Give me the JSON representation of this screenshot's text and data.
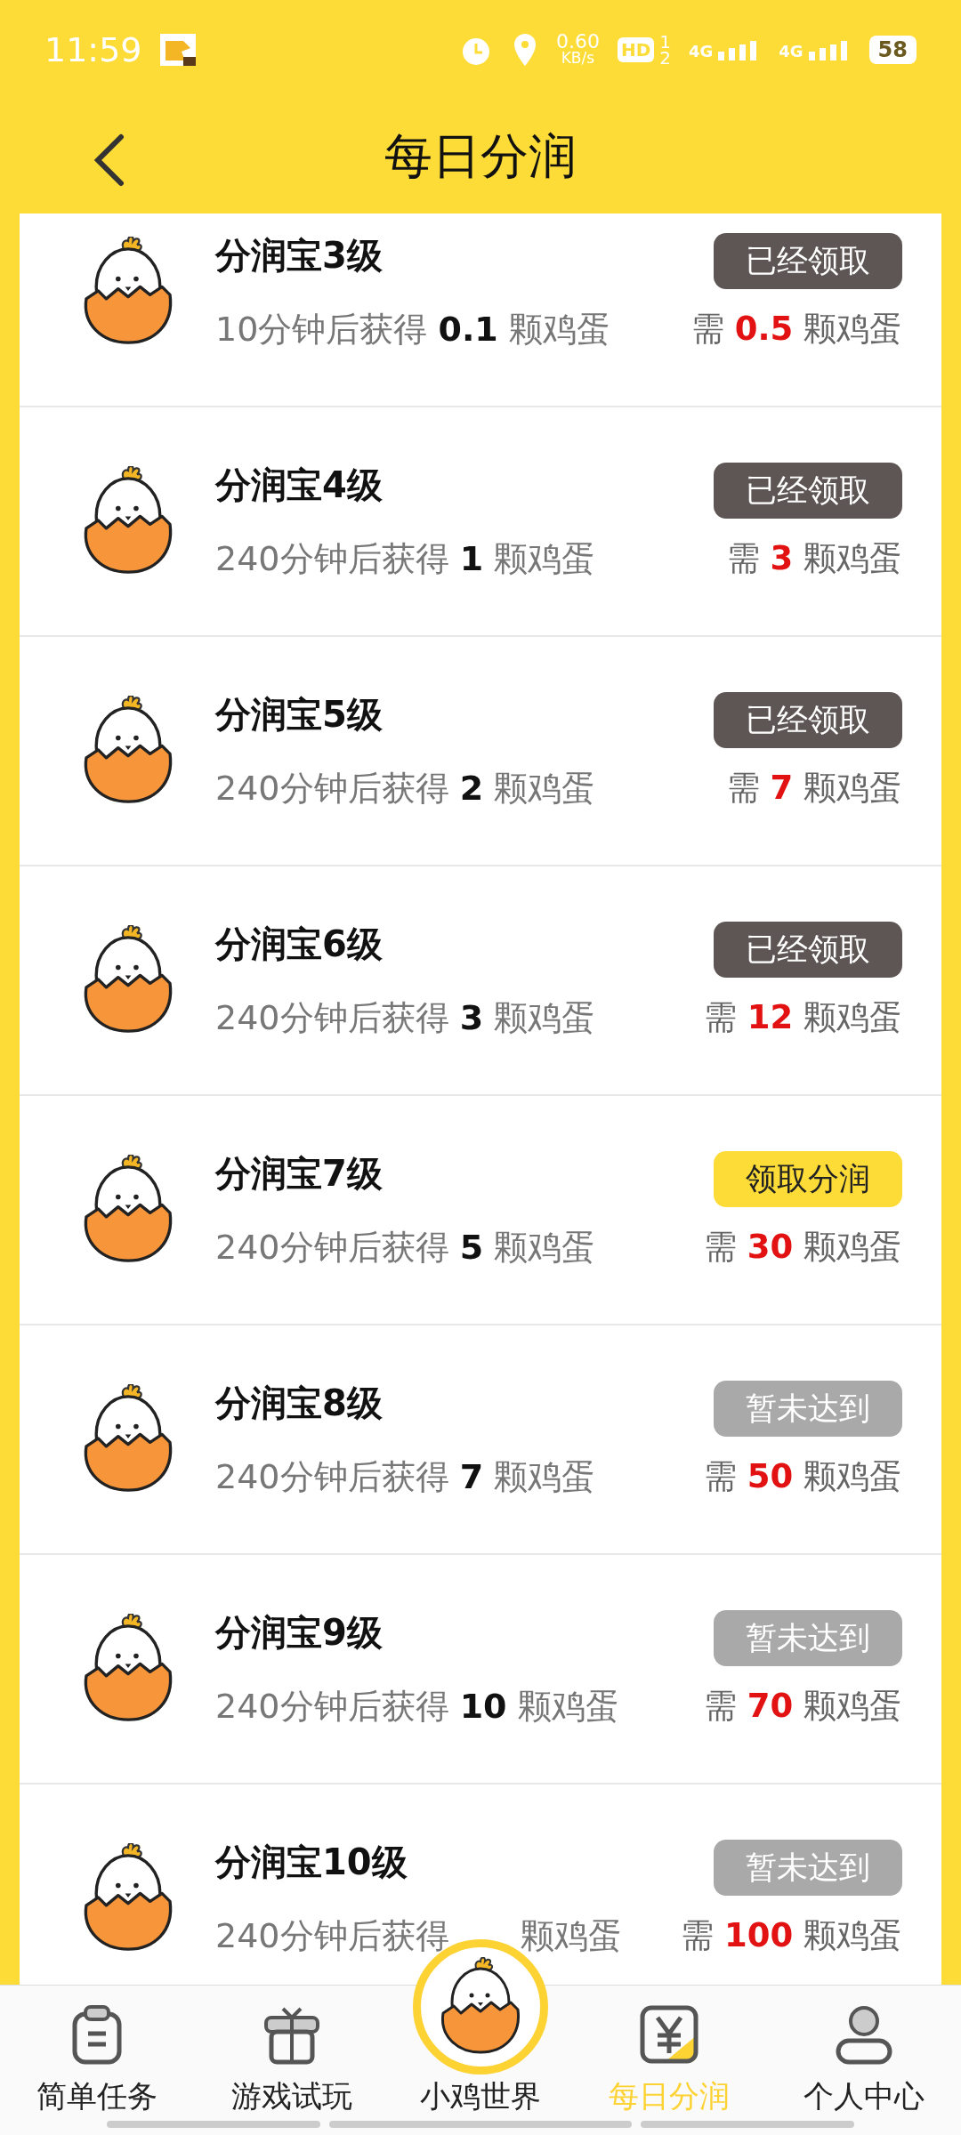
{
  "status_bar": {
    "time": "11:59",
    "speed": "0.60",
    "speed_unit": "KB/s",
    "hd": "HD",
    "sim1": "1",
    "sim2": "2",
    "net1": "4G",
    "net2": "4G",
    "battery": "58"
  },
  "header": {
    "title": "每日分润"
  },
  "rows": [
    {
      "title": "分润宝3级",
      "reward_prefix": "10分钟后获得",
      "reward": "0.1",
      "reward_suffix": "颗鸡蛋",
      "button": "已经领取",
      "kind": "claimed",
      "need_prefix": "需",
      "need": "0.5",
      "need_suffix": "颗鸡蛋"
    },
    {
      "title": "分润宝4级",
      "reward_prefix": "240分钟后获得",
      "reward": "1",
      "reward_suffix": "颗鸡蛋",
      "button": "已经领取",
      "kind": "claimed",
      "need_prefix": "需",
      "need": "3",
      "need_suffix": "颗鸡蛋"
    },
    {
      "title": "分润宝5级",
      "reward_prefix": "240分钟后获得",
      "reward": "2",
      "reward_suffix": "颗鸡蛋",
      "button": "已经领取",
      "kind": "claimed",
      "need_prefix": "需",
      "need": "7",
      "need_suffix": "颗鸡蛋"
    },
    {
      "title": "分润宝6级",
      "reward_prefix": "240分钟后获得",
      "reward": "3",
      "reward_suffix": "颗鸡蛋",
      "button": "已经领取",
      "kind": "claimed",
      "need_prefix": "需",
      "need": "12",
      "need_suffix": "颗鸡蛋"
    },
    {
      "title": "分润宝7级",
      "reward_prefix": "240分钟后获得",
      "reward": "5",
      "reward_suffix": "颗鸡蛋",
      "button": "领取分润",
      "kind": "claimable",
      "need_prefix": "需",
      "need": "30",
      "need_suffix": "颗鸡蛋"
    },
    {
      "title": "分润宝8级",
      "reward_prefix": "240分钟后获得",
      "reward": "7",
      "reward_suffix": "颗鸡蛋",
      "button": "暂未达到",
      "kind": "locked",
      "need_prefix": "需",
      "need": "50",
      "need_suffix": "颗鸡蛋"
    },
    {
      "title": "分润宝9级",
      "reward_prefix": "240分钟后获得",
      "reward": "10",
      "reward_suffix": "颗鸡蛋",
      "button": "暂未达到",
      "kind": "locked",
      "need_prefix": "需",
      "need": "70",
      "need_suffix": "颗鸡蛋"
    },
    {
      "title": "分润宝10级",
      "reward_prefix": "240分钟后获得",
      "reward_suffix": "颗鸡蛋",
      "button": "暂未达到",
      "kind": "locked",
      "need_prefix": "需",
      "need": "100",
      "need_suffix": "颗鸡蛋"
    }
  ],
  "nav": [
    {
      "label": "简单任务",
      "kind": "tasks",
      "selected": false
    },
    {
      "label": "游戏试玩",
      "kind": "gift",
      "selected": false
    },
    {
      "label": "小鸡世界",
      "kind": "center",
      "selected": false
    },
    {
      "label": "每日分润",
      "kind": "money",
      "selected": true
    },
    {
      "label": "个人中心",
      "kind": "person",
      "selected": false
    }
  ]
}
